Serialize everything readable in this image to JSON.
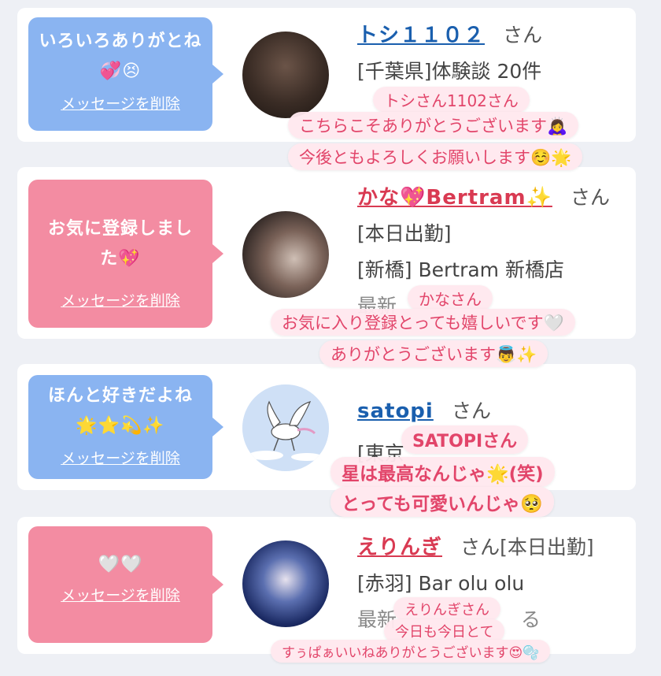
{
  "items": [
    {
      "message": "いろいろありがとね💞😣",
      "delete_label": "メッセージを削除",
      "username": "トシ１１０２",
      "san": "さん",
      "line1": "[千葉県]体験談 20件",
      "line2": "",
      "overlay": [
        "トシさん1102さん",
        "こちらこそありがとうございます🙇‍♀️",
        "今後ともよろしくお願いします☺️🌟"
      ]
    },
    {
      "message": "お気に登録しました💖",
      "delete_label": "メッセージを削除",
      "username": "かな💖Bertram✨",
      "san": "さん",
      "line1": "[本日出勤]",
      "line2": "[新橋] Bertram 新橋店",
      "line3": "最新",
      "overlay": [
        "かなさん",
        "お気に入り登録とっても嬉しいです🤍",
        "ありがとうございます👼✨"
      ]
    },
    {
      "message": "ほんと好きだよね🌟⭐💫✨",
      "delete_label": "メッセージを削除",
      "username": "satopi",
      "san": "さん",
      "line1": "[東京",
      "overlay": [
        "SATOPIさん",
        "星は最高なんじゃ🌟(笑)",
        "とっても可愛いんじゃ🥺"
      ]
    },
    {
      "message": "🤍🤍",
      "delete_label": "メッセージを削除",
      "username": "えりんぎ",
      "san": "さん[本日出勤]",
      "line1": "[赤羽] Bar olu olu",
      "line2": "最新",
      "line2_tail": "る",
      "overlay": [
        "えりんぎさん",
        "今日も今日とて",
        "すぅぱぁいいねありがとうございます😍🫧"
      ]
    }
  ]
}
